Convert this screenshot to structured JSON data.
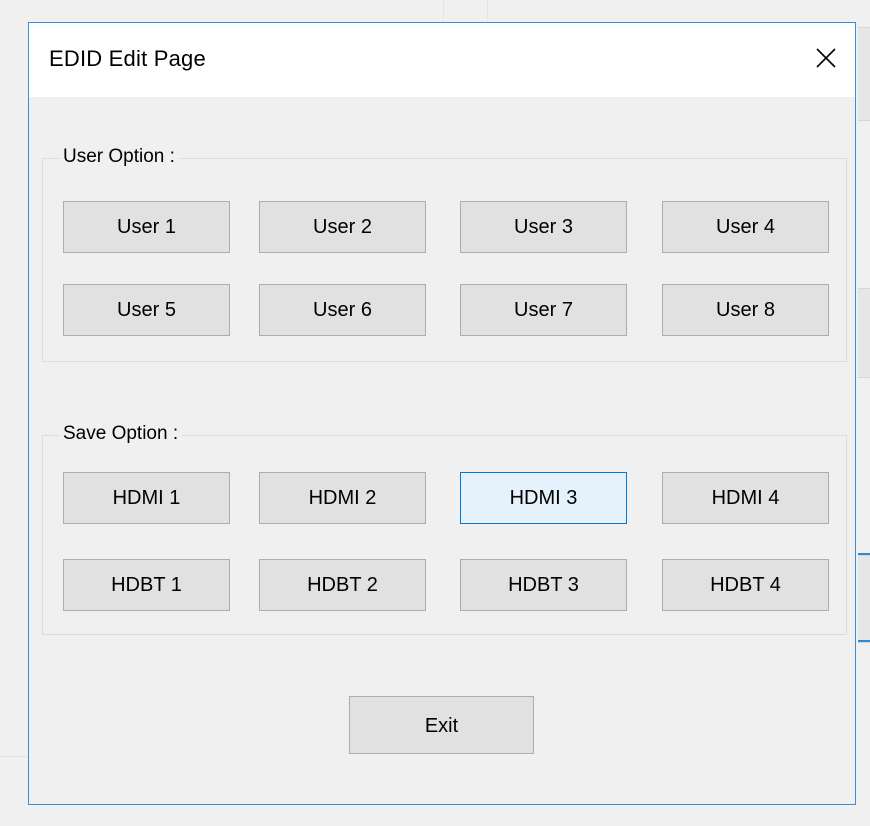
{
  "dialog": {
    "title": "EDID Edit Page",
    "close_icon": "close-icon"
  },
  "user_option": {
    "label": "User Option :",
    "buttons": [
      "User 1",
      "User 2",
      "User 3",
      "User 4",
      "User 5",
      "User 6",
      "User 7",
      "User 8"
    ]
  },
  "save_option": {
    "label": "Save Option :",
    "buttons": [
      "HDMI 1",
      "HDMI 2",
      "HDMI 3",
      "HDMI 4",
      "HDBT 1",
      "HDBT 2",
      "HDBT 3",
      "HDBT 4"
    ]
  },
  "exit": {
    "label": "Exit"
  },
  "colors": {
    "window_border": "#3c8fd7",
    "button_face": "#e1e1e1",
    "button_border": "#adadad",
    "hover_face": "#e5f1fb",
    "hover_border": "#0078d7"
  }
}
